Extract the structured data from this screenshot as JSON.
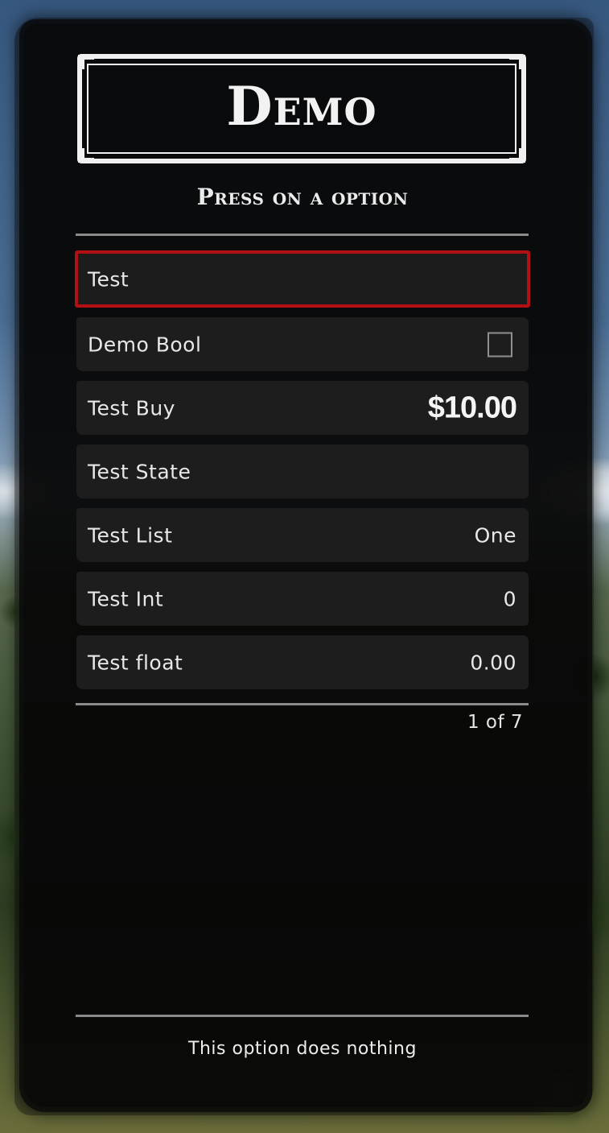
{
  "menu": {
    "title": "Demo",
    "subtitle": "Press on a option",
    "items": [
      {
        "label": "Test",
        "value": "",
        "type": "button",
        "selected": true
      },
      {
        "label": "Demo Bool",
        "value": "",
        "type": "toggle",
        "checked": false
      },
      {
        "label": "Test Buy",
        "value": "$10.00",
        "type": "purchase"
      },
      {
        "label": "Test State",
        "value": "",
        "type": "state"
      },
      {
        "label": "Test List",
        "value": "One",
        "type": "list"
      },
      {
        "label": "Test Int",
        "value": "0",
        "type": "int"
      },
      {
        "label": "Test float",
        "value": "0.00",
        "type": "float"
      }
    ],
    "pager": "1 of 7",
    "description": "This option does nothing"
  },
  "colors": {
    "panel": "#060606",
    "item_bg": "#1d1d1d",
    "selected_border": "#b40f12",
    "text": "#e8e8e8",
    "divider": "#8a8a8a"
  }
}
